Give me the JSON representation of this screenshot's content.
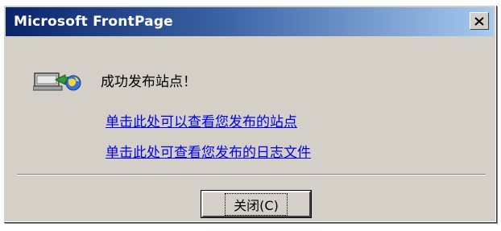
{
  "window": {
    "title": "Microsoft FrontPage",
    "close_glyph": "x"
  },
  "icon": {
    "name": "site-computer-icon"
  },
  "message": "成功发布站点！",
  "links": {
    "view_site": "单击此处可以查看您发布的站点",
    "view_log": "单击此处可查看您发布的日志文件"
  },
  "buttons": {
    "close_label": "关闭(C)"
  },
  "colors": {
    "titlebar_start": "#0a246a",
    "titlebar_end": "#a6caf0",
    "dialog_bg": "#d4d0c8",
    "link": "#0000ee"
  }
}
